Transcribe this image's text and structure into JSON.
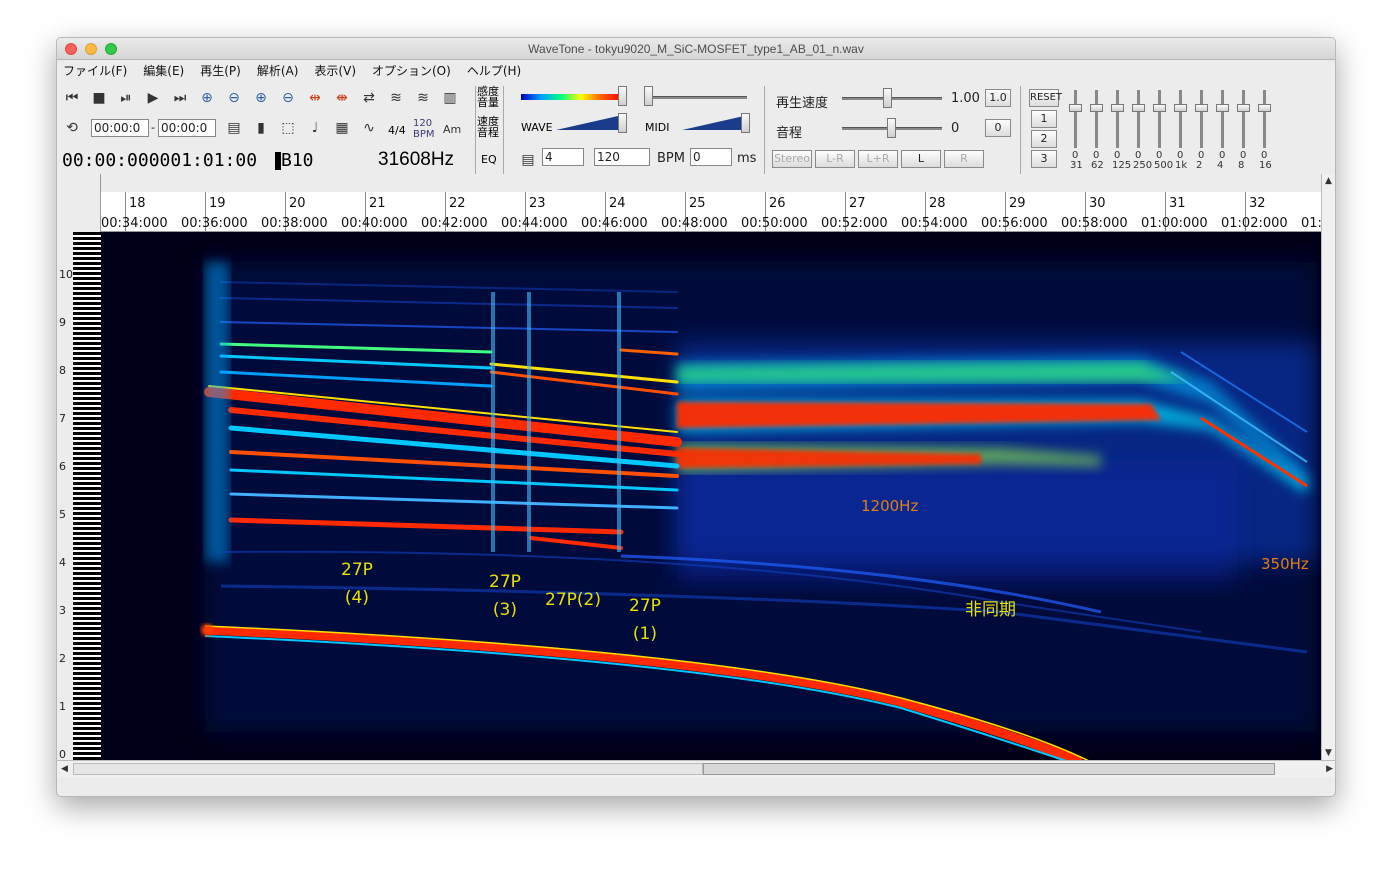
{
  "window": {
    "title": "WaveTone - tokyu9020_M_SiC-MOSFET_type1_AB_01_n.wav"
  },
  "menu": [
    "ファイル(F)",
    "編集(E)",
    "再生(P)",
    "解析(A)",
    "表示(V)",
    "オプション(O)",
    "ヘルプ(H)"
  ],
  "toolbar": {
    "start_time": "00:00:0",
    "end_time": "00:00:0",
    "time_sig": "4/4",
    "bpm_icon": "120\nBPM",
    "chord_icon": "Am",
    "position_display": "00:00:000001:01:00",
    "marker_text": "B10",
    "frequency_display": "31608Hz",
    "eq_label": "EQ",
    "sens_label": "感度\n音量",
    "speed_label": "速度\n音程",
    "wave_label": "WAVE",
    "midi_label": "MIDI",
    "beats_value": "4",
    "bpm_value": "120",
    "bpm_label": "BPM",
    "ms_value": "0",
    "ms_label": "ms",
    "speed_text": "再生速度",
    "speed_value": "1.00",
    "speed_reset": "1.0",
    "pitch_text": "音程",
    "pitch_value": "0",
    "pitch_reset": "0",
    "channel_buttons": [
      "Stereo",
      "L-R",
      "L+R",
      "L",
      "R"
    ],
    "reset_label": "RESET",
    "preset_buttons": [
      "1",
      "2",
      "3"
    ],
    "eq_bands": [
      "31",
      "62",
      "125",
      "250",
      "500",
      "1k",
      "2",
      "4",
      "8",
      "16"
    ],
    "eq_values": [
      "0",
      "0",
      "0",
      "0",
      "0",
      "0",
      "0",
      "0",
      "0",
      "0"
    ]
  },
  "ruler": {
    "bars": [
      "18",
      "19",
      "20",
      "21",
      "22",
      "23",
      "24",
      "25",
      "26",
      "27",
      "28",
      "29",
      "30",
      "31",
      "32"
    ],
    "times": [
      "00:34:000",
      "00:36:000",
      "00:38:000",
      "00:40:000",
      "00:42:000",
      "00:44:000",
      "00:46:000",
      "00:48:000",
      "00:50:000",
      "00:52:000",
      "00:54:000",
      "00:56:000",
      "00:58:000",
      "01:00:000",
      "01:02:000",
      "01:"
    ]
  },
  "piano": {
    "octaves": [
      "10",
      "9",
      "8",
      "7",
      "6",
      "5",
      "4",
      "3",
      "2",
      "1",
      "0"
    ]
  },
  "annotations": {
    "a4": "27P\n(4)",
    "a3": "27P\n(3)",
    "a2": "27P(2)",
    "a1": "27P\n(1)",
    "async": "非同期",
    "hz1200": "1200Hz",
    "hz350": "350Hz"
  },
  "colors": {
    "spectrogram_bg": "#000018",
    "hot": "#ff2a00",
    "warm": "#ffe000",
    "cool": "#00c8ff",
    "annotation_yellow": "#e8e000",
    "annotation_orange": "#e08010"
  }
}
